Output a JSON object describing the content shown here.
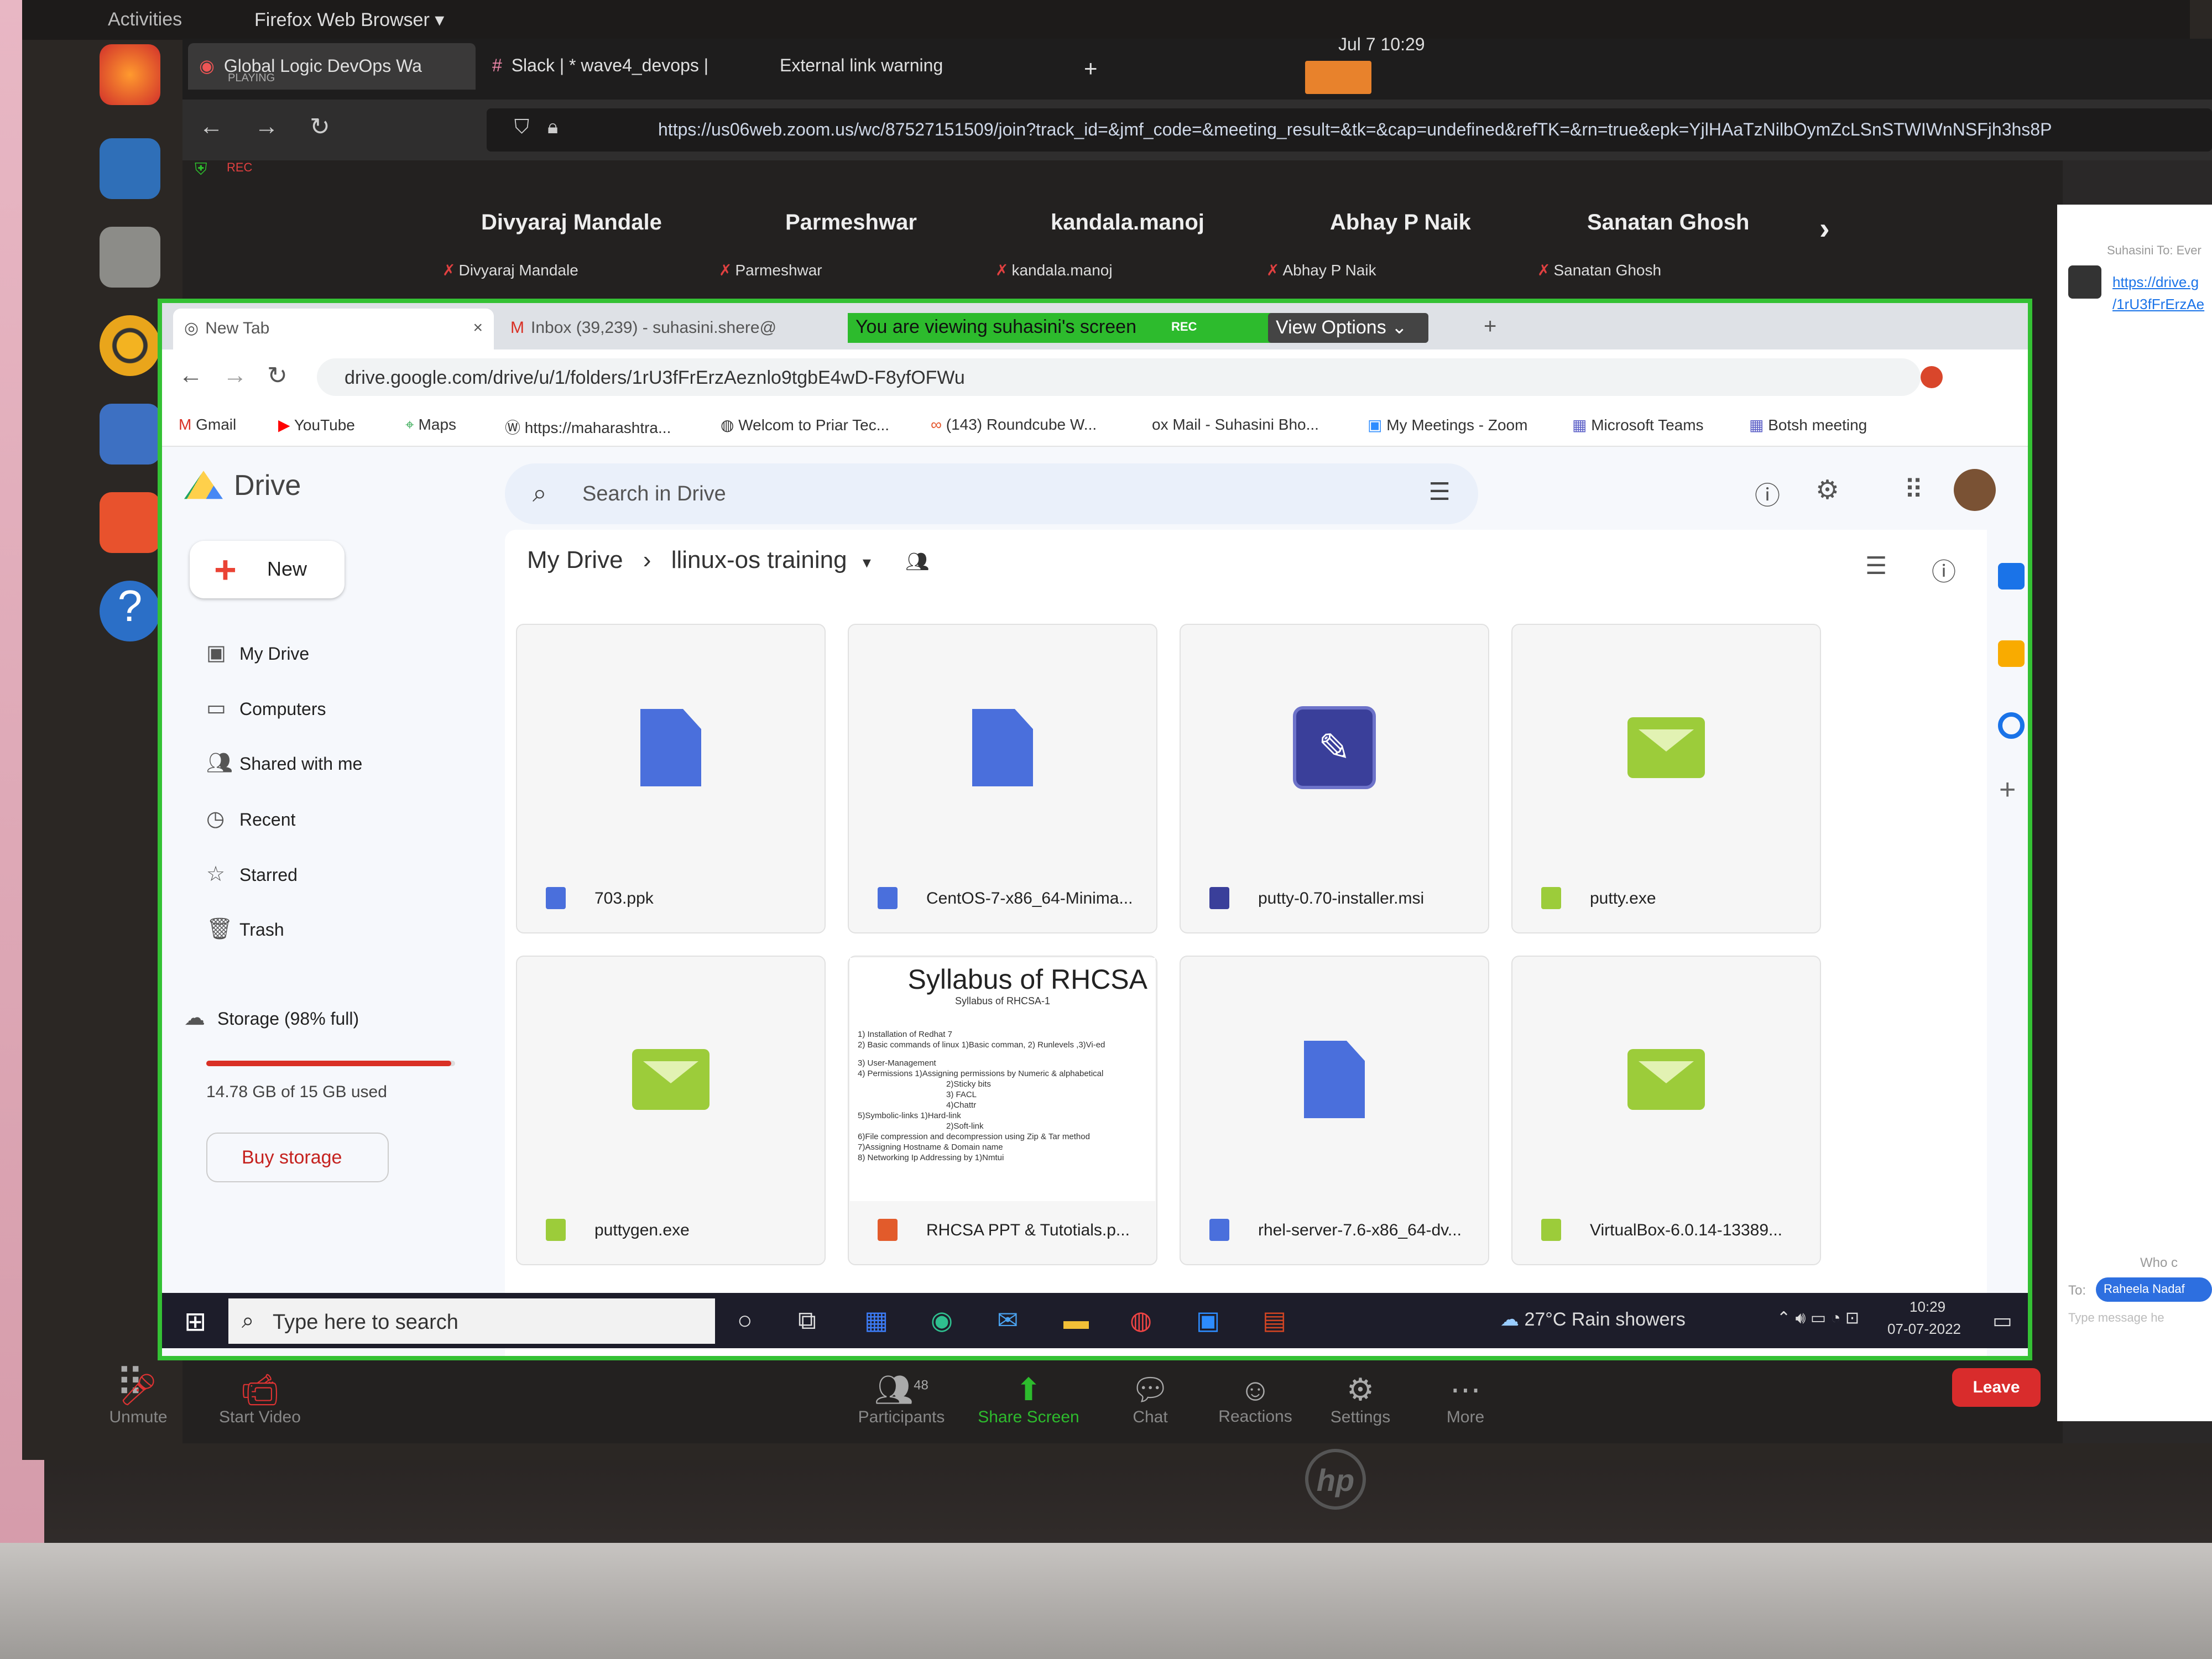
{
  "ubuntu": {
    "activities": "Activities",
    "app_menu": "Firefox Web Browser ▾",
    "clock": "Jul 7  10:29"
  },
  "firefox": {
    "tabs": [
      {
        "label": "Global Logic DevOps Wa",
        "sub": "PLAYING"
      },
      {
        "label": "Slack | * wave4_devops |"
      },
      {
        "label": "External link warning"
      }
    ],
    "url": "https://us06web.zoom.us/wc/87527151509/join?track_id=&jmf_code=&meeting_result=&tk=&cap=undefined&refTK=&rn=true&epk=YjlHAaTzNilbOymZcLSnSTWIWnNSFjh3hs8P"
  },
  "zoom": {
    "rec": "REC",
    "participants": [
      {
        "name": "Divyaraj Mandale"
      },
      {
        "name": "Parmeshwar"
      },
      {
        "name": "kandala.manoj"
      },
      {
        "name": "Abhay P Naik"
      },
      {
        "name": "Sanatan Ghosh"
      }
    ],
    "banner": "You are viewing suhasini's screen",
    "banner_rec": "REC",
    "view_options": "View Options ⌄",
    "toolbar": {
      "unmute": "Unmute",
      "start_video": "Start Video",
      "participants": "Participants",
      "participants_count": "48",
      "share_screen": "Share Screen",
      "chat": "Chat",
      "reactions": "Reactions",
      "settings": "Settings",
      "more": "More",
      "leave": "Leave"
    },
    "chat_panel": {
      "header": "Suhasini To: Ever",
      "link1": "https://drive.g",
      "link2": "/1rU3fFrErzAe",
      "who": "Who c",
      "to_label": "To:",
      "to_name": "Raheela Nadaf",
      "placeholder": "Type message he"
    }
  },
  "chrome": {
    "tabs": [
      {
        "label": "New Tab"
      },
      {
        "label": "Inbox (39,239) - suhasini.shere@"
      }
    ],
    "url": "drive.google.com/drive/u/1/folders/1rU3fFrErzAeznlo9tgbE4wD-F8yfOFWu",
    "bookmarks": [
      "Gmail",
      "YouTube",
      "Maps",
      "https://maharashtra...",
      "Welcom to Priar Tec...",
      "(143) Roundcube W...",
      "Mail - Suhasini Bho...",
      "My Meetings - Zoom",
      "Microsoft Teams",
      "Botsh meeting"
    ]
  },
  "drive": {
    "logo": "Drive",
    "search_placeholder": "Search in Drive",
    "new_label": "New",
    "nav": [
      "My Drive",
      "Computers",
      "Shared with me",
      "Recent",
      "Starred",
      "Trash"
    ],
    "storage_label": "Storage (98% full)",
    "storage_used": "14.78 GB of 15 GB used",
    "storage_fraction": 0.985,
    "buy_storage": "Buy storage",
    "breadcrumb_root": "My Drive",
    "breadcrumb_folder": "llinux-os training",
    "files": [
      {
        "name": "703.ppk",
        "kind": "doc"
      },
      {
        "name": "CentOS-7-x86_64-Minima...",
        "kind": "doc"
      },
      {
        "name": "putty-0.70-installer.msi",
        "kind": "msi"
      },
      {
        "name": "putty.exe",
        "kind": "exe"
      },
      {
        "name": "puttygen.exe",
        "kind": "exe"
      },
      {
        "name": "RHCSA PPT & Tutotials.p...",
        "kind": "slides"
      },
      {
        "name": "rhel-server-7.6-x86_64-dv...",
        "kind": "doc"
      },
      {
        "name": "VirtualBox-6.0.14-13389...",
        "kind": "exe"
      }
    ],
    "slide_preview": {
      "title": "Syllabus of RHCSA",
      "subtitle": "Syllabus of RHCSA-1",
      "lines": [
        "1) Installation of Redhat 7",
        "2) Basic commands of linux  1)Basic comman, 2) Runlevels ,3)Vi-ed",
        "3) User-Management",
        "4) Permissions   1)Assigning permissions by Numeric & alphabetical",
        "2)Sticky bits",
        "3) FACL",
        "4)Chattr",
        "5)Symbolic-links  1)Hard-link",
        "2)Soft-link",
        "6)File compression and decompression using Zip & Tar method",
        "7)Assigning Hostname & Domain name",
        "8) Networking    Ip Addressing  by 1)Nmtui"
      ]
    }
  },
  "windows": {
    "search_placeholder": "Type here to search",
    "weather": "27°C  Rain showers",
    "time": "10:29",
    "date": "07-07-2022"
  }
}
